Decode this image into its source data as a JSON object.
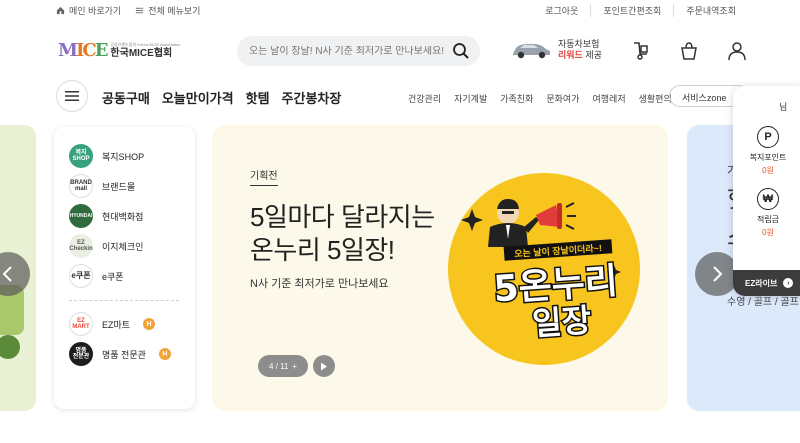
{
  "topbar": {
    "home_label": "메인 바로가기",
    "allmenu_label": "전체 메뉴보기",
    "links": [
      "로그아웃",
      "포인트간편조회",
      "주문내역조회"
    ]
  },
  "header": {
    "logo_small": "공동브랜드협의 Korea MICE Association",
    "logo_name": "한국MICE협회",
    "search_placeholder": "오는 날이 장날! N사 기준 최저가로 만나보세요!",
    "promo_line1": "자동차보험",
    "promo_highlight": "리워드",
    "promo_line2_suffix": " 제공",
    "icons": [
      "delivery-icon",
      "cart-icon",
      "user-icon"
    ]
  },
  "nav": {
    "main": [
      "공동구매",
      "오늘만이가격",
      "핫템",
      "주간봉차장"
    ],
    "sub": [
      "건강관리",
      "자기계발",
      "가족친화",
      "문화여가",
      "여행레저",
      "생활편의"
    ],
    "service_zone": "서비스zone"
  },
  "categories": {
    "items": [
      {
        "label": "복지SHOP",
        "icon_text": "복지\nSHOP",
        "color": "#3aa17e"
      },
      {
        "label": "브랜드몰",
        "icon_text": "BRAND\nmall",
        "color": "#ffffff"
      },
      {
        "label": "현대백화점",
        "icon_text": "HYUNDAI",
        "color": "#2f6b3c"
      },
      {
        "label": "이지체크인",
        "icon_text": "EZ\nCheckin",
        "color": "#e9efe1"
      },
      {
        "label": "e쿠폰",
        "icon_text": "e쿠폰",
        "color": "#ffffff"
      }
    ],
    "extra": [
      {
        "label": "EZ마트",
        "icon_text": "EZ\nMART",
        "color": "#ffffff",
        "badge": "H"
      },
      {
        "label": "명품 전문관",
        "icon_text": "명품\n전문관",
        "color": "#1d1d1d",
        "badge": "H"
      }
    ]
  },
  "banner": {
    "tag": "기획전",
    "title_line1": "5일마다 달라지는",
    "title_line2": "온누리 5일장!",
    "subtitle": "N사 기준 최저가로 만나보세요",
    "pager": "4 / 11",
    "pager_plus": "+",
    "art_caption": "오는 날이 장날이더라~!",
    "art_title_1": "5온누리",
    "art_title_2": "일장"
  },
  "right_card": {
    "text_lines": [
      "기",
      "핫",
      "스"
    ],
    "sub": "수영 / 골프 / 골프"
  },
  "float_panel": {
    "user_suffix": "님",
    "items": [
      {
        "label": "복지포인트",
        "value": "0원",
        "icon": "point-icon",
        "glyph": "P"
      },
      {
        "label": "적립금",
        "value": "0원",
        "icon": "won-icon",
        "glyph": "₩"
      }
    ],
    "live_label": "EZ라이브",
    "live_arrow": "›"
  },
  "colors": {
    "banner_bg": "#fdf9ea",
    "art_yellow": "#f7c51e",
    "accent_red": "#e2522e",
    "right_card_bg": "#dbe9fb",
    "left_strip_bg": "#e9f1d4"
  }
}
